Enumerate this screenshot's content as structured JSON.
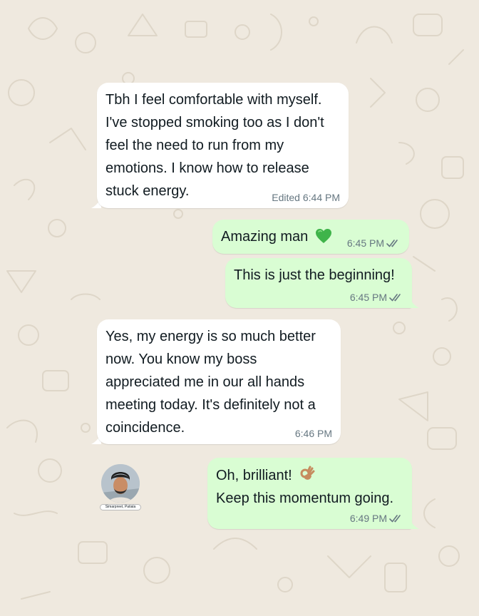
{
  "theme": {
    "wallpaper": "#efe9df",
    "incoming_bubble": "#ffffff",
    "outgoing_bubble": "#d9fdd3",
    "read_ticks": "#667781",
    "timestamp": "#667781"
  },
  "messages": [
    {
      "direction": "incoming",
      "text": "Tbh I feel comfortable with myself.\nI've stopped smoking too as I don't\nfeel the need to run from my\nemotions. I know how to release\nstuck energy.",
      "time": "Edited 6:44 PM"
    },
    {
      "direction": "outgoing",
      "text": "Amazing man",
      "emoji": "green-heart-icon",
      "time": "6:45 PM",
      "status": "read"
    },
    {
      "direction": "outgoing",
      "text": "This is just the beginning!",
      "time": "6:45 PM",
      "status": "read"
    },
    {
      "direction": "incoming",
      "text": "Yes, my energy is so much better\nnow. You know my boss\nappreciated me in our all hands\nmeeting today. It's definitely not a\ncoincidence.",
      "time": "6:46 PM"
    },
    {
      "direction": "outgoing",
      "line1": "Oh, brilliant!",
      "emoji": "ok-hand-icon",
      "line2": "Keep this momentum going.",
      "time": "6:49 PM",
      "status": "read"
    }
  ],
  "avatar": {
    "name": "Simarpreet, Patiala",
    "icon": "profile-photo"
  }
}
